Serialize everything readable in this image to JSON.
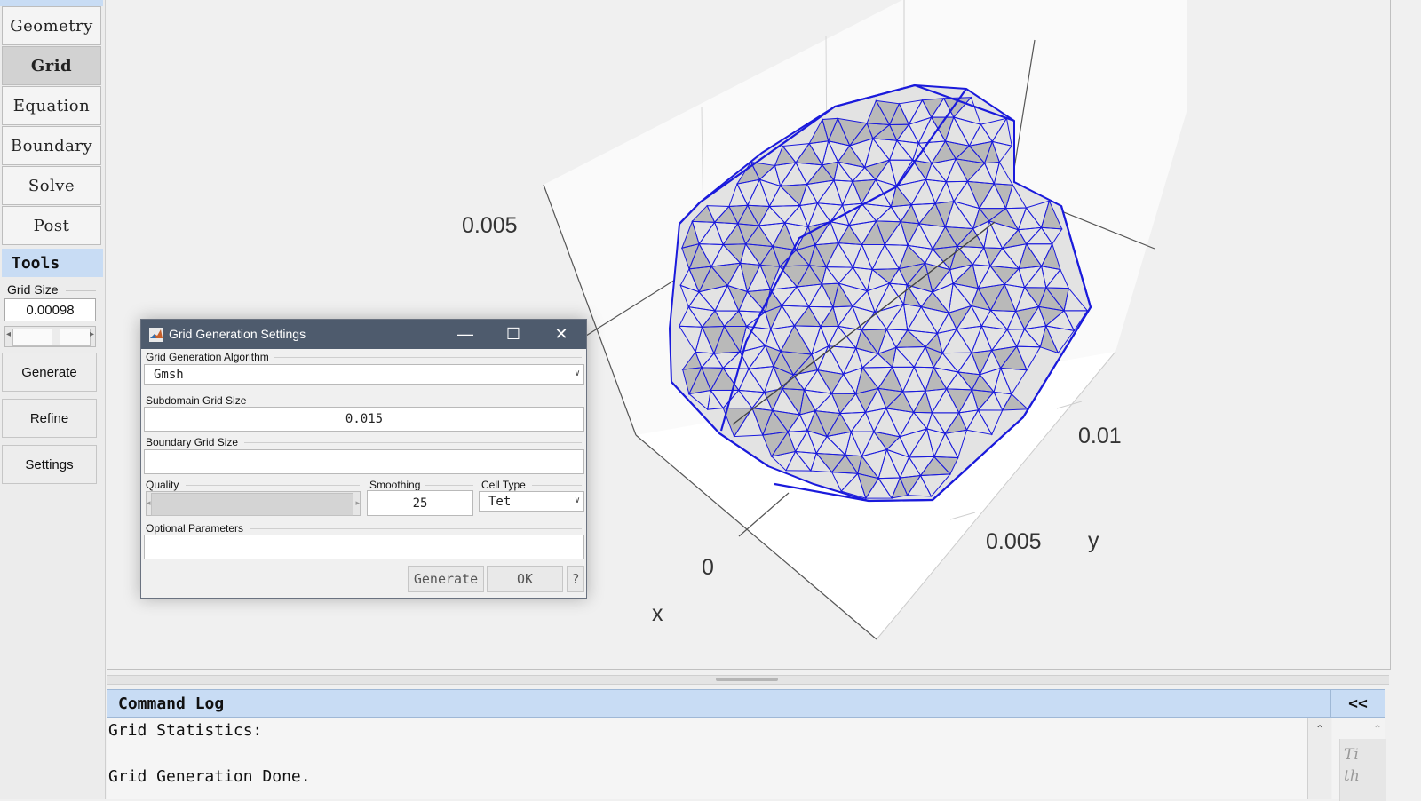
{
  "sidebar": {
    "nav": [
      {
        "label": "Geometry",
        "active": false
      },
      {
        "label": "Grid",
        "active": true
      },
      {
        "label": "Equation",
        "active": false
      },
      {
        "label": "Boundary",
        "active": false
      },
      {
        "label": "Solve",
        "active": false
      },
      {
        "label": "Post",
        "active": false
      }
    ],
    "tools_label": "Tools",
    "grid_size_label": "Grid Size",
    "grid_size_value": "0.00098",
    "generate_label": "Generate",
    "refine_label": "Refine",
    "settings_label": "Settings"
  },
  "plot": {
    "tick_labels": {
      "z": "0.005",
      "y_far": "0.01",
      "y_mid": "0.005",
      "y_axis": "y",
      "x_zero": "0",
      "x_axis": "x"
    },
    "mesh_color": "#1a1adc",
    "face_color": "#e2e2e2",
    "shadow_color": "#b9b9b9"
  },
  "log": {
    "title": "Command Log",
    "collapse_label": "<<",
    "lines": [
      "Grid Statistics:",
      "",
      "Grid Generation Done."
    ],
    "tip_text": [
      "Ti",
      "th"
    ]
  },
  "dialog": {
    "title": "Grid Generation Settings",
    "algorithm_label": "Grid Generation Algorithm",
    "algorithm_value": "Gmsh",
    "subdomain_label": "Subdomain Grid Size",
    "subdomain_value": "0.015",
    "boundary_label": "Boundary Grid Size",
    "boundary_value": "",
    "quality_label": "Quality",
    "smoothing_label": "Smoothing",
    "smoothing_value": "25",
    "celltype_label": "Cell Type",
    "celltype_value": "Tet",
    "optional_label": "Optional Parameters",
    "optional_value": "",
    "generate_label": "Generate",
    "ok_label": "OK",
    "help_label": "?"
  }
}
